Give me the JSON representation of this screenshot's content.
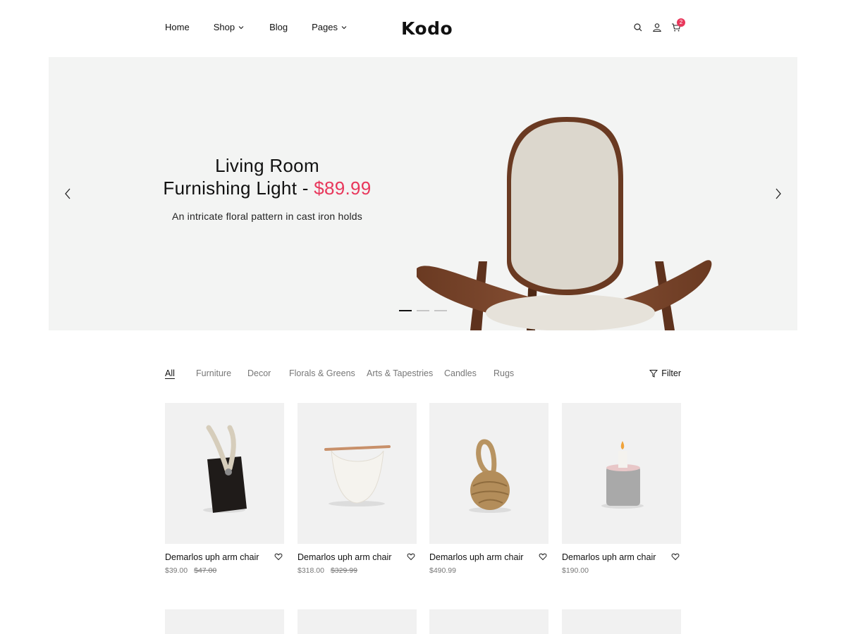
{
  "header": {
    "nav": [
      {
        "label": "Home"
      },
      {
        "label": "Shop"
      },
      {
        "label": "Blog"
      },
      {
        "label": "Pages"
      }
    ],
    "logo": "Kodo",
    "cart_count": "2",
    "icons": [
      "search-icon",
      "user-icon",
      "cart-icon"
    ]
  },
  "hero": {
    "title_line1": "Living Room",
    "title_line2": "Furnishing Light - ",
    "price": "$89.99",
    "subtitle": "An intricate floral pattern in cast iron holds",
    "slides": 3,
    "active_slide": 1
  },
  "filters": {
    "tabs": [
      "All",
      "Furniture",
      "Decor",
      "Florals & Greens",
      "Arts & Tapestries",
      "Candles",
      "Rugs"
    ],
    "active": "All",
    "filter_label": "Filter"
  },
  "products": [
    {
      "name": "Demarlos uph arm chair",
      "price": "$39.00",
      "old_price": "$47.00"
    },
    {
      "name": "Demarlos uph arm chair",
      "price": "$318.00",
      "old_price": "$329.99"
    },
    {
      "name": "Demarlos uph arm chair",
      "price": "$490.99",
      "old_price": ""
    },
    {
      "name": "Demarlos uph arm chair",
      "price": "$190.00",
      "old_price": ""
    }
  ],
  "colors": {
    "accent": "#e8375b",
    "hero_bg": "#f3f4f3",
    "card_bg": "#f1f1f1"
  }
}
